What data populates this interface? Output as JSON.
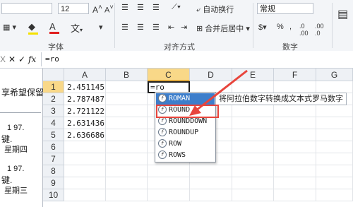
{
  "ribbon": {
    "font_size": "12",
    "wrap_text": "自动换行",
    "merge_center": "合并后居中",
    "number_format": "常规",
    "group_font": "字体",
    "group_alignment": "对齐方式",
    "group_number": "数字"
  },
  "formula_bar": {
    "name_box": "X",
    "fx_label": "fx",
    "content": "=ro"
  },
  "columns": [
    "A",
    "B",
    "C",
    "D",
    "E",
    "F",
    "G"
  ],
  "rows": [
    "1",
    "2",
    "3",
    "4",
    "5",
    "6",
    "7",
    "8",
    "9",
    "10"
  ],
  "cells": {
    "a1": "2.451145",
    "a2": "2.787487",
    "a3": "2.721122",
    "a4": "2.631436",
    "a5": "2.636686",
    "c1": "=ro"
  },
  "left_pane": {
    "line1": "享希望保留",
    "line2": "1  97.",
    "line3": "键.",
    "line4": "星期四",
    "line5": "1  97.",
    "line6": "键.",
    "line7": "星期三"
  },
  "autocomplete": {
    "items": [
      "ROMAN",
      "ROUND",
      "ROUNDDOWN",
      "ROUNDUP",
      "ROW",
      "ROWS"
    ],
    "selected": "ROMAN",
    "tooltip": "将阿拉伯数字转换成文本式罗马数字"
  },
  "colors": {
    "selection_blue": "#3d7ecb",
    "highlight_red": "#e8453c",
    "header_selected": "#f9d888"
  }
}
